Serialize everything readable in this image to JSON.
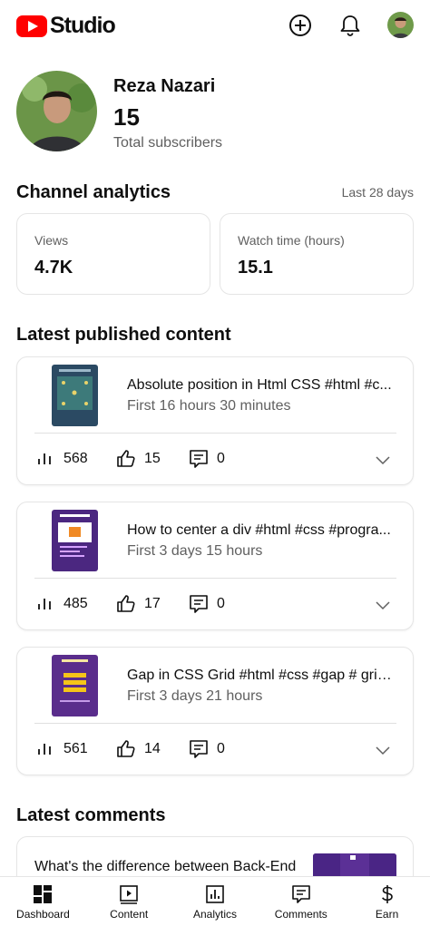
{
  "app": {
    "logo_text": "Studio"
  },
  "header": {
    "icons": [
      "create-icon",
      "bell-icon",
      "avatar"
    ]
  },
  "profile": {
    "name": "Reza Nazari",
    "subscribers": "15",
    "subscribers_label": "Total subscribers"
  },
  "analytics": {
    "title": "Channel analytics",
    "range": "Last 28 days",
    "metrics": [
      {
        "label": "Views",
        "value": "4.7K"
      },
      {
        "label": "Watch time (hours)",
        "value": "15.1"
      }
    ]
  },
  "latest": {
    "title": "Latest published content",
    "videos": [
      {
        "title": "Absolute position in Html CSS #html #c...",
        "time": "First 16 hours 30 minutes",
        "views": "568",
        "likes": "15",
        "comments": "0"
      },
      {
        "title": "How to center a div #html #css #progra...",
        "time": "First 3 days 15 hours",
        "views": "485",
        "likes": "17",
        "comments": "0"
      },
      {
        "title": "Gap in CSS Grid #html #css #gap # grid...",
        "time": "First 3 days 21 hours",
        "views": "561",
        "likes": "14",
        "comments": "0"
      }
    ]
  },
  "comments": {
    "title": "Latest comments",
    "items": [
      {
        "text": "What's the difference between Back-End"
      }
    ]
  },
  "nav": {
    "items": [
      {
        "label": "Dashboard",
        "icon": "dashboard-icon"
      },
      {
        "label": "Content",
        "icon": "content-icon"
      },
      {
        "label": "Analytics",
        "icon": "analytics-icon"
      },
      {
        "label": "Comments",
        "icon": "comments-icon"
      },
      {
        "label": "Earn",
        "icon": "dollar-icon"
      }
    ]
  },
  "colors": {
    "brand_red": "#ff0000",
    "muted_text": "#606060",
    "border": "#e5e5e5"
  }
}
